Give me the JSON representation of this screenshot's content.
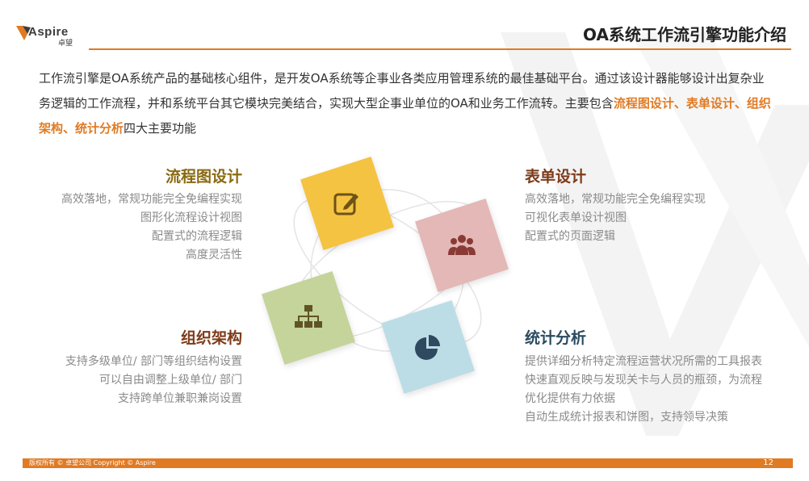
{
  "header": {
    "logo_text": "Aspire",
    "logo_cn": "卓望",
    "title": "OA系统工作流引擎功能介绍"
  },
  "intro": {
    "text_a": "工作流引擎是OA系统产品的基础核心组件，是开发OA系统等企事业各类应用管理系统的最佳基础平台。通过该设计器能够设计出复杂业务逻辑的工作流程，并和系统平台其它模块完美结合，实现大型企事业单位的OA和业务工作流转。主要包含",
    "highlight": "流程图设计、表单设计、组织架构、统计分析",
    "text_b": "四大主要功能"
  },
  "sections": {
    "flow": {
      "title": "流程图设计",
      "lines": [
        "高效落地，常规功能完全免编程实现",
        "图形化流程设计视图",
        "配置式的流程逻辑",
        "高度灵活性"
      ]
    },
    "form": {
      "title": "表单设计",
      "lines": [
        "高效落地，常规功能完全免编程实现",
        "可视化表单设计视图",
        "配置式的页面逻辑"
      ]
    },
    "org": {
      "title": "组织架构",
      "lines": [
        "支持多级单位/ 部门等组织结构设置",
        "可以自由调整上级单位/ 部门",
        "支持跨单位兼职兼岗设置"
      ]
    },
    "stats": {
      "title": "统计分析",
      "lines": [
        "提供详细分析特定流程运营状况所需的工具报表",
        "快速直观反映与发现关卡与人员的瓶颈，为流程",
        "优化提供有力依据",
        "自动生成统计报表和饼图，支持领导决策"
      ]
    }
  },
  "colors": {
    "accent": "#e07b24",
    "card_flow": "#f5c342",
    "card_form": "#e3b8b6",
    "card_org": "#c5d49a",
    "card_stats": "#bcdde6",
    "icon_flow": "#6e5316",
    "icon_form": "#8a3a35",
    "icon_org": "#5f5428",
    "icon_stats": "#2f4a60",
    "title_flow": "#8a6a10",
    "title_form": "#7d3b1a",
    "title_org": "#7d3b1a",
    "title_stats": "#2a4a60"
  },
  "icons": {
    "flow": "edit-icon",
    "form": "users-icon",
    "org": "org-chart-icon",
    "stats": "pie-chart-icon"
  },
  "footer": {
    "copyright": "版权所有 © 卓望公司      Copyright © Aspire",
    "page_number": "12"
  }
}
